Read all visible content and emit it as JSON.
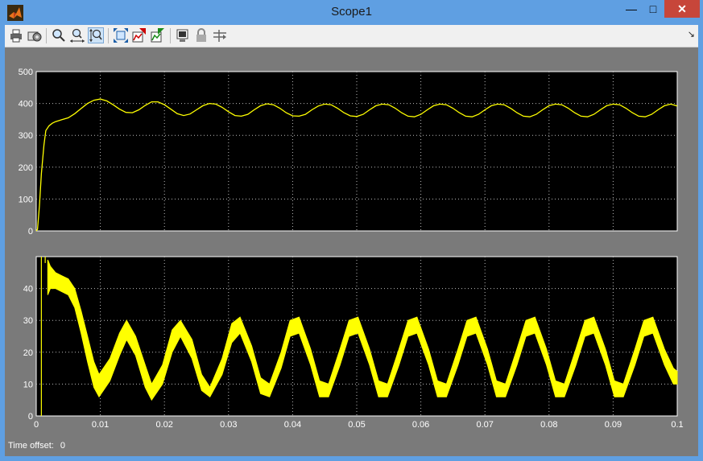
{
  "window": {
    "title": "Scope1"
  },
  "titlebar": {
    "minimize_icon": "minimize-icon",
    "maximize_icon": "maximize-icon",
    "close_icon": "close-icon"
  },
  "toolbar": {
    "icons": [
      "print-icon",
      "parameters-icon",
      "zoom-icon",
      "zoom-x-icon",
      "zoom-y-icon",
      "autoscale-icon",
      "save-axes-icon",
      "restore-axes-icon",
      "floating-scope-icon",
      "lock-axes-icon",
      "signal-selection-icon"
    ]
  },
  "status": {
    "label": "Time offset:",
    "value": "0"
  },
  "colors": {
    "trace": "#ffff00",
    "plot_bg": "#000000",
    "frame_bg": "#7a7a7a",
    "titlebar": "#5f9fe2"
  },
  "chart_data": [
    {
      "type": "line",
      "title": "",
      "xlabel": "",
      "ylabel": "",
      "xlim": [
        0,
        0.1
      ],
      "ylim": [
        0,
        500
      ],
      "xticks": [
        "0",
        "0.01",
        "0.02",
        "0.03",
        "0.04",
        "0.05",
        "0.06",
        "0.07",
        "0.08",
        "0.09",
        "0.1"
      ],
      "yticks": [
        "0",
        "100",
        "200",
        "300",
        "400",
        "500"
      ],
      "grid": true,
      "series": [
        {
          "x": [
            0,
            0.0002,
            0.0005,
            0.0008,
            0.0012,
            0.0015,
            0.002,
            0.0025,
            0.003,
            0.0035,
            0.004,
            0.005,
            0.006,
            0.007,
            0.008,
            0.009,
            0.01,
            0.011,
            0.012,
            0.013,
            0.014,
            0.015,
            0.016,
            0.017,
            0.018,
            0.019,
            0.02,
            0.021,
            0.022,
            0.023,
            0.024,
            0.025,
            0.026,
            0.027,
            0.028,
            0.029,
            0.03,
            0.031,
            0.032,
            0.033,
            0.034,
            0.035,
            0.036,
            0.037,
            0.038,
            0.039,
            0.04,
            0.041,
            0.042,
            0.043,
            0.044,
            0.045,
            0.046,
            0.047,
            0.048,
            0.049,
            0.05,
            0.051,
            0.052,
            0.053,
            0.054,
            0.055,
            0.056,
            0.057,
            0.058,
            0.059,
            0.06,
            0.061,
            0.062,
            0.063,
            0.064,
            0.065,
            0.066,
            0.067,
            0.068,
            0.069,
            0.07,
            0.071,
            0.072,
            0.073,
            0.074,
            0.075,
            0.076,
            0.077,
            0.078,
            0.079,
            0.08,
            0.081,
            0.082,
            0.083,
            0.084,
            0.085,
            0.086,
            0.087,
            0.088,
            0.089,
            0.09,
            0.091,
            0.092,
            0.093,
            0.094,
            0.095,
            0.096,
            0.097,
            0.098,
            0.099,
            0.1
          ],
          "y": [
            0,
            5,
            80,
            180,
            270,
            315,
            330,
            338,
            343,
            346,
            349,
            355,
            368,
            384,
            400,
            410,
            414,
            408,
            396,
            382,
            372,
            371,
            380,
            394,
            405,
            405,
            396,
            382,
            368,
            362,
            367,
            380,
            393,
            400,
            398,
            388,
            374,
            362,
            360,
            366,
            380,
            393,
            399,
            396,
            385,
            371,
            361,
            360,
            366,
            380,
            392,
            398,
            396,
            385,
            371,
            361,
            359,
            366,
            380,
            393,
            398,
            396,
            385,
            371,
            360,
            358,
            366,
            380,
            393,
            398,
            396,
            385,
            371,
            360,
            358,
            366,
            380,
            393,
            398,
            396,
            385,
            371,
            360,
            358,
            366,
            380,
            393,
            398,
            396,
            385,
            371,
            360,
            358,
            366,
            380,
            393,
            398,
            396,
            385,
            371,
            360,
            358,
            366,
            380,
            393,
            398,
            392
          ]
        }
      ]
    },
    {
      "type": "area",
      "title": "",
      "xlabel": "",
      "ylabel": "",
      "xlim": [
        0,
        0.1
      ],
      "ylim": [
        0,
        50
      ],
      "xticks": [
        "0",
        "0.01",
        "0.02",
        "0.03",
        "0.04",
        "0.05",
        "0.06",
        "0.07",
        "0.08",
        "0.09",
        "0.1"
      ],
      "yticks": [
        "0",
        "10",
        "20",
        "30",
        "40"
      ],
      "grid": true,
      "series": [
        {
          "name": "",
          "x": [
            0.0018,
            0.0022,
            0.003,
            0.004,
            0.005,
            0.006,
            0.007,
            0.008,
            0.009,
            0.0098,
            0.0115,
            0.013,
            0.0141,
            0.0155,
            0.017,
            0.018,
            0.0197,
            0.0212,
            0.0225,
            0.0243,
            0.0258,
            0.0271,
            0.029,
            0.0305,
            0.0318,
            0.0336,
            0.035,
            0.0364,
            0.0382,
            0.0396,
            0.041,
            0.0428,
            0.0442,
            0.0456,
            0.0474,
            0.0488,
            0.0502,
            0.052,
            0.0534,
            0.0548,
            0.0566,
            0.058,
            0.0594,
            0.0612,
            0.0626,
            0.064,
            0.0658,
            0.0672,
            0.0686,
            0.0704,
            0.0718,
            0.0732,
            0.075,
            0.0764,
            0.0778,
            0.0796,
            0.081,
            0.0824,
            0.0842,
            0.0856,
            0.087,
            0.0888,
            0.0902,
            0.0916,
            0.0934,
            0.0948,
            0.0962,
            0.098,
            0.0994,
            0.1
          ],
          "upper": [
            49,
            47,
            45,
            44,
            43,
            40,
            33,
            25,
            17,
            13,
            18,
            26,
            30,
            25,
            16,
            10,
            16,
            27,
            30,
            24,
            13,
            9,
            18,
            29,
            31,
            22,
            12,
            10,
            20,
            30,
            31,
            21,
            11,
            10,
            21,
            30,
            31,
            21,
            11,
            10,
            21,
            30,
            31,
            21,
            11,
            10,
            21,
            30,
            31,
            21,
            11,
            10,
            21,
            30,
            31,
            21,
            11,
            10,
            21,
            30,
            31,
            21,
            11,
            10,
            21,
            30,
            31,
            21,
            15,
            14
          ],
          "lower": [
            38,
            40,
            40,
            39,
            38,
            34,
            26,
            17,
            9,
            6,
            11,
            19,
            24,
            19,
            9,
            5,
            10,
            20,
            25,
            18,
            8,
            6,
            13,
            23,
            26,
            17,
            7,
            6,
            15,
            25,
            26,
            16,
            6,
            6,
            16,
            25,
            26,
            16,
            6,
            6,
            16,
            25,
            26,
            16,
            6,
            6,
            16,
            25,
            26,
            16,
            6,
            6,
            16,
            25,
            26,
            16,
            6,
            6,
            16,
            25,
            26,
            16,
            6,
            6,
            16,
            25,
            26,
            16,
            10,
            10
          ]
        }
      ]
    }
  ]
}
